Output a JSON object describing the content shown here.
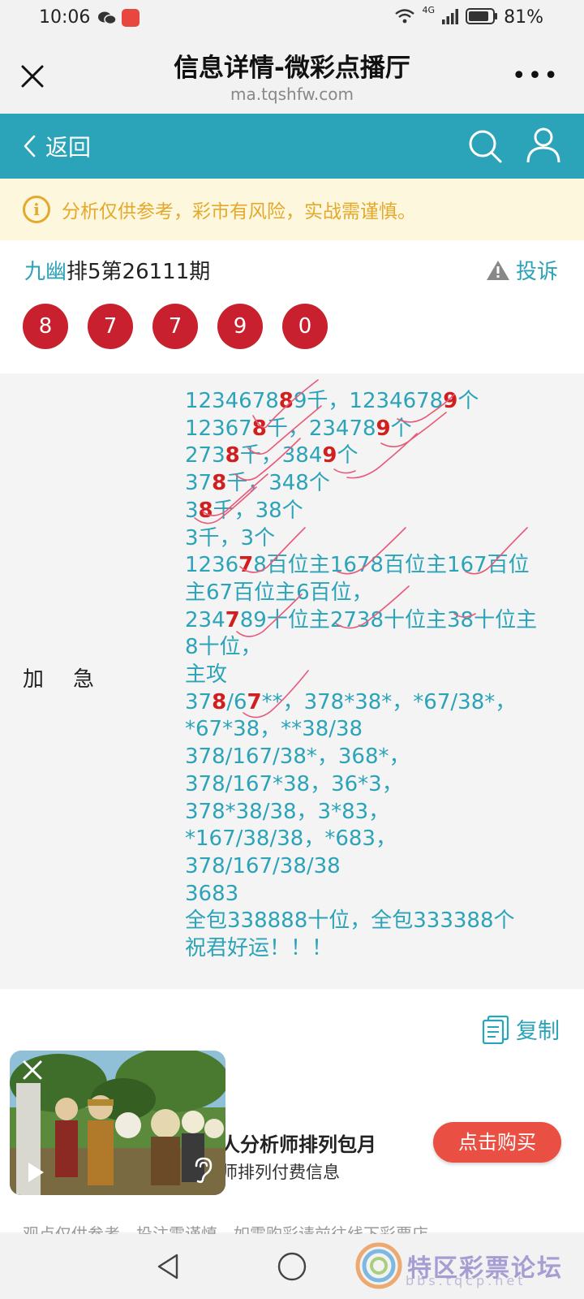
{
  "status_bar": {
    "time": "10:06",
    "battery": "81%",
    "network": "4G"
  },
  "browser": {
    "title": "信息详情-微彩点播厅",
    "url": "ma.tqshfw.com"
  },
  "nav": {
    "back_label": "返回"
  },
  "notice": {
    "text": "分析仅供参考，彩市有风险，实战需谨慎。"
  },
  "issue": {
    "author": "九幽",
    "title": "排5第26111期",
    "complain_label": "投诉",
    "numbers": [
      "8",
      "7",
      "7",
      "9",
      "0"
    ]
  },
  "content": {
    "label": "加急",
    "lines": [
      [
        {
          "t": "1234678"
        },
        {
          "t": "8",
          "h": true
        },
        {
          "t": "9千，1234678"
        },
        {
          "t": "9",
          "h": true
        },
        {
          "t": "个"
        }
      ],
      [
        {
          "t": "12367"
        },
        {
          "t": "8",
          "h": true
        },
        {
          "t": "千，23478"
        },
        {
          "t": "9",
          "h": true
        },
        {
          "t": "个"
        }
      ],
      [
        {
          "t": "273"
        },
        {
          "t": "8",
          "h": true
        },
        {
          "t": "千，384"
        },
        {
          "t": "9",
          "h": true
        },
        {
          "t": "个"
        }
      ],
      [
        {
          "t": "37"
        },
        {
          "t": "8",
          "h": true
        },
        {
          "t": "千，348个"
        }
      ],
      [
        {
          "t": "3"
        },
        {
          "t": "8",
          "h": true
        },
        {
          "t": "千，38个"
        }
      ],
      [
        {
          "t": "3千，3个"
        }
      ],
      [
        {
          "t": "1236"
        },
        {
          "t": "7",
          "h": true
        },
        {
          "t": "8百位主1678百位主167百位"
        }
      ],
      [
        {
          "t": "主67百位主6百位，"
        }
      ],
      [
        {
          "t": "234"
        },
        {
          "t": "7",
          "h": true
        },
        {
          "t": "89十位主2738十位主38十位主"
        }
      ],
      [
        {
          "t": "8十位，"
        }
      ],
      [
        {
          "t": "主攻"
        }
      ],
      [
        {
          "t": "37"
        },
        {
          "t": "8",
          "h": true
        },
        {
          "t": "/6"
        },
        {
          "t": "7",
          "h": true
        },
        {
          "t": "**，378*38*，*67/38*，"
        }
      ],
      [
        {
          "t": "*67*38，**38/38"
        }
      ],
      [
        {
          "t": "378/167/38*，368*，"
        }
      ],
      [
        {
          "t": "378/167*38，36*3，"
        }
      ],
      [
        {
          "t": "378*38/38，3*83，"
        }
      ],
      [
        {
          "t": "*167/38/38，*683，"
        }
      ],
      [
        {
          "t": "378/167/38/38"
        }
      ],
      [
        {
          "t": "3683"
        }
      ],
      [
        {
          "t": "全包338888十位，全包333388个"
        }
      ],
      [
        {
          "t": "祝君好运！！！"
        }
      ]
    ]
  },
  "copy_label": "复制",
  "promo": {
    "title": "人分析师排列包月",
    "subtitle": "师排列付费信息",
    "buy_label": "点击购买"
  },
  "footer_note": "观点仅供参考，投注需谨慎，如需购彩请前往线下彩票店",
  "watermark": {
    "text": "特区彩票论坛",
    "url": "bbs.tqcp.net"
  },
  "colors": {
    "accent": "#2ba3b8",
    "ball": "#c8202f",
    "highlight": "#d01f1f",
    "notice": "#e4a92c",
    "buy": "#ea4f43"
  }
}
